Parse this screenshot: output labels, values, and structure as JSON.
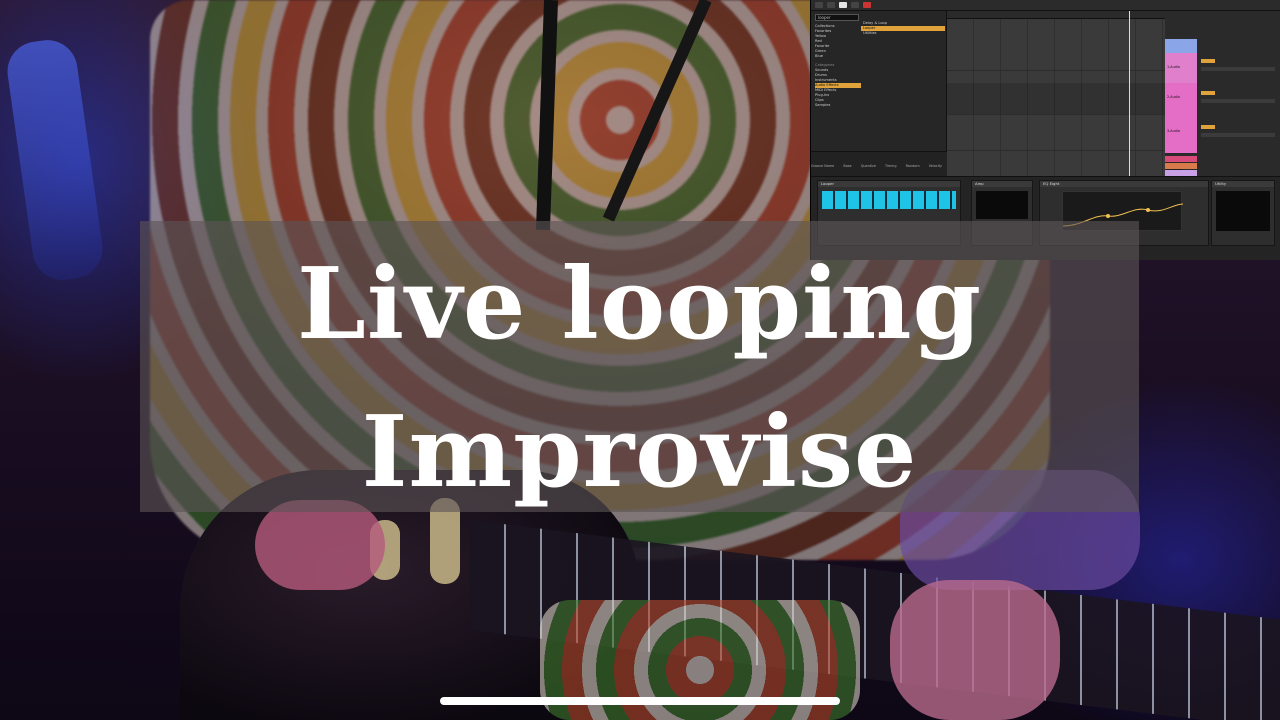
{
  "overlay": {
    "line1": "Live looping",
    "line2": "Improvise"
  },
  "daw": {
    "search_value": "looper",
    "categories": [
      "Collections",
      "Favorites",
      "Yellow",
      "Red",
      "Favorite",
      "Green",
      "Blue"
    ],
    "categories_heading": "Categories",
    "library": [
      "Sounds",
      "Drums",
      "Instruments",
      "Audio Effects",
      "MIDI Effects",
      "Plug-ins",
      "Clips",
      "Samples"
    ],
    "files": [
      "Delay & Loop",
      "Looper",
      "Utilities"
    ],
    "groove_labels": [
      "Groove Name",
      "Base",
      "Quantize",
      "Timing",
      "Random",
      "Velocity"
    ],
    "mixer_tracks": [
      "1-Audio",
      "2-Audio",
      "3-Audio",
      "A Reverb",
      "B Delay",
      "Master"
    ],
    "devices": [
      "Looper",
      "Amp",
      "EQ Eight",
      "Utility"
    ],
    "colors": {
      "accent": "#e0a23a",
      "track_pink": "#e46ec6",
      "track_blue": "#8aa6e8",
      "looper_wave": "#1fc3e6"
    }
  },
  "ui": {
    "home_indicator_color": "#ffffff"
  }
}
